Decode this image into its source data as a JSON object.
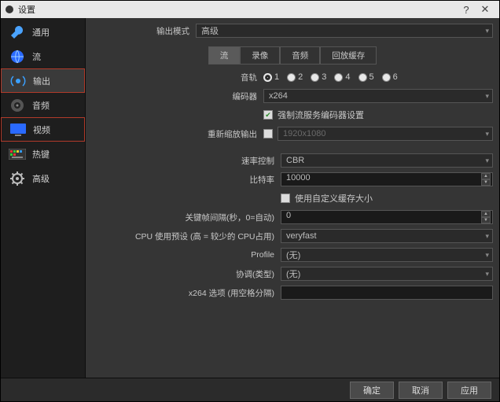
{
  "window": {
    "title": "设置"
  },
  "titlebar": {
    "help": "?",
    "close": "✕"
  },
  "sidebar": {
    "items": [
      {
        "label": "通用",
        "name": "sidebar-item-general"
      },
      {
        "label": "流",
        "name": "sidebar-item-stream"
      },
      {
        "label": "输出",
        "name": "sidebar-item-output"
      },
      {
        "label": "音频",
        "name": "sidebar-item-audio"
      },
      {
        "label": "视频",
        "name": "sidebar-item-video"
      },
      {
        "label": "热键",
        "name": "sidebar-item-hotkeys"
      },
      {
        "label": "高级",
        "name": "sidebar-item-advanced"
      }
    ]
  },
  "main": {
    "output_mode": {
      "label": "输出模式",
      "value": "高级"
    },
    "tabs": [
      {
        "label": "流",
        "active": true
      },
      {
        "label": "录像",
        "active": false
      },
      {
        "label": "音频",
        "active": false
      },
      {
        "label": "回放缓存",
        "active": false
      }
    ],
    "tracks": {
      "label": "音轨",
      "options": [
        "1",
        "2",
        "3",
        "4",
        "5",
        "6"
      ],
      "selected": "1"
    },
    "encoder": {
      "label": "编码器",
      "value": "x264"
    },
    "enforce": {
      "label": "强制流服务编码器设置",
      "checked": true
    },
    "rescale": {
      "label": "重新缩放输出",
      "checked": false,
      "value": "1920x1080"
    },
    "rate_control": {
      "label": "速率控制",
      "value": "CBR"
    },
    "bitrate": {
      "label": "比特率",
      "value": "10000"
    },
    "custom_buffer": {
      "label": "使用自定义缓存大小",
      "checked": false
    },
    "keyframe": {
      "label": "关键帧间隔(秒，0=自动)",
      "value": "0"
    },
    "cpu_preset": {
      "label": "CPU 使用预设 (高 = 较少的 CPU占用)",
      "value": "veryfast"
    },
    "profile": {
      "label": "Profile",
      "value": "(无)"
    },
    "tune": {
      "label": "协调(类型)",
      "value": "(无)"
    },
    "x264opts": {
      "label": "x264 选项 (用空格分隔)",
      "value": ""
    }
  },
  "footer": {
    "ok": "确定",
    "cancel": "取消",
    "apply": "应用"
  }
}
